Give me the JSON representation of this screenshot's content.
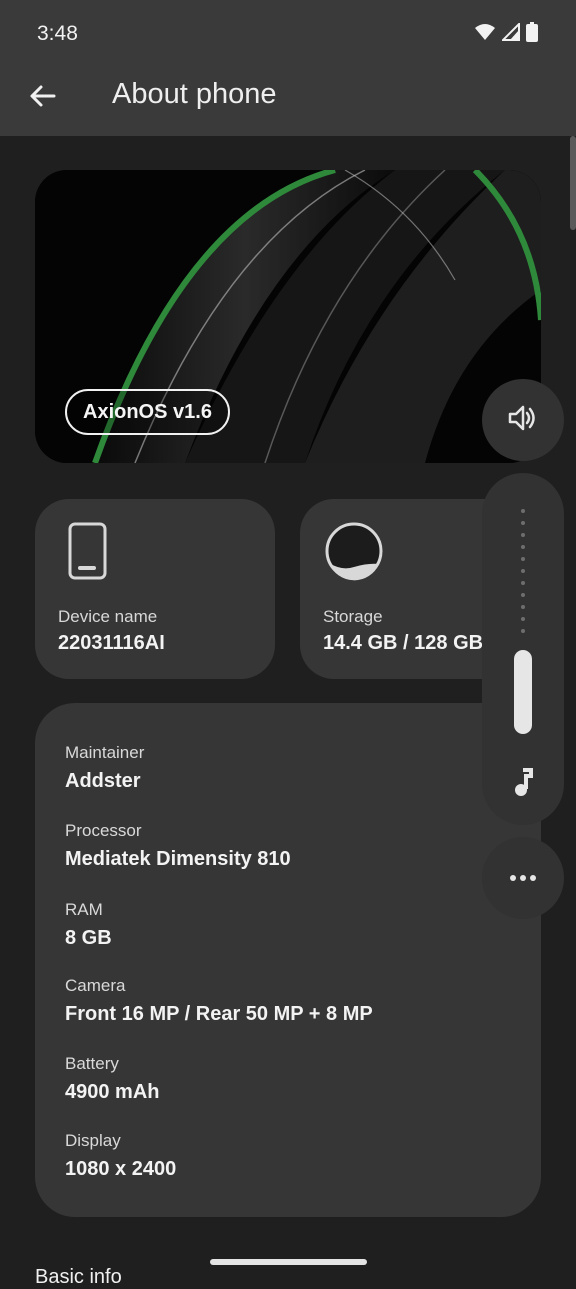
{
  "status_bar": {
    "time": "3:48",
    "icons": [
      "wifi-icon",
      "cellular-icon",
      "battery-icon"
    ]
  },
  "app_bar": {
    "title": "About phone",
    "back_icon": "arrow-back-icon"
  },
  "hero": {
    "os_version": "AxionOS v1.6",
    "accent_color": "#2e8a3a"
  },
  "device_card": {
    "icon": "phone-icon",
    "label": "Device name",
    "value": "22031116AI"
  },
  "storage_card": {
    "icon": "storage-gauge-icon",
    "label": "Storage",
    "value": "14.4 GB / 128 GB",
    "used_fraction": 0.11
  },
  "info": [
    {
      "label": "Maintainer",
      "value": "Addster"
    },
    {
      "label": "Processor",
      "value": "Mediatek Dimensity 810"
    },
    {
      "label": "RAM",
      "value": "8 GB"
    },
    {
      "label": "Camera",
      "value": "Front 16 MP / Rear 50 MP + 8 MP"
    },
    {
      "label": "Battery",
      "value": "4900 mAh"
    },
    {
      "label": "Display",
      "value": "1080 x 2400"
    }
  ],
  "section_header": "Basic info",
  "volume_panel": {
    "speaker_icon": "volume-icon",
    "media_icon": "music-note-icon",
    "more_icon": "more-horizontal-icon",
    "level_fraction": 0.35
  }
}
